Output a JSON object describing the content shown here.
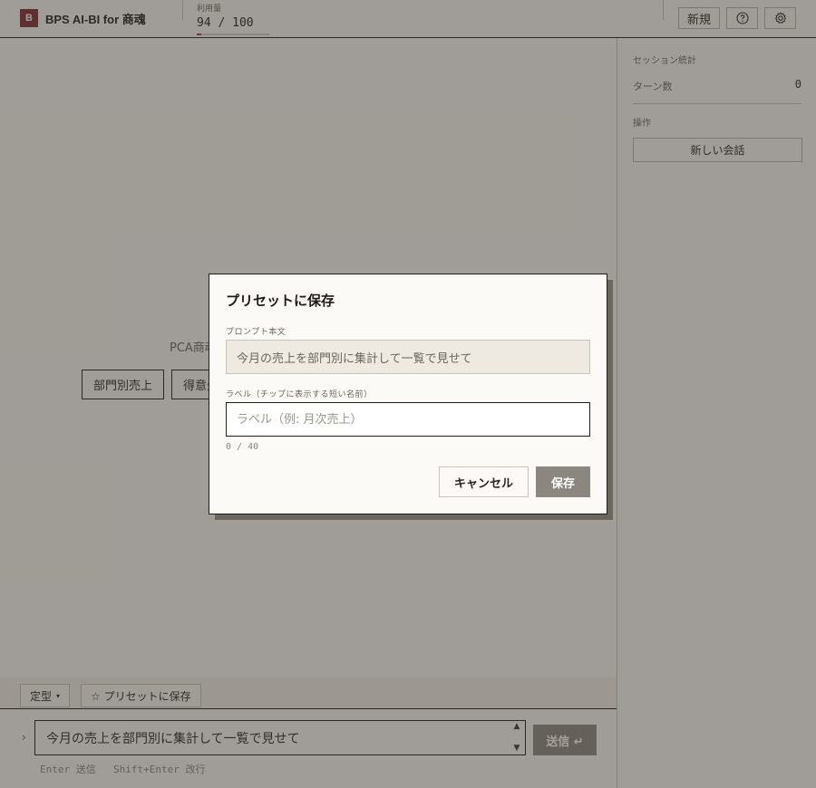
{
  "header": {
    "logo_letter": "B",
    "app_title": "BPS AI-BI for 商魂",
    "usage_label": "利用量",
    "usage_value": "94 / 100",
    "usage_fraction": 0.06,
    "new_label": "新規",
    "help_icon": "question-circle-icon",
    "settings_icon": "gear-icon"
  },
  "main": {
    "welcome_text": "PCA商魂",
    "chips": [
      "部門別売上",
      "得意先"
    ],
    "toolbar": {
      "template_label": "定型",
      "template_caret": "▾",
      "preset_label": "☆ プリセットに保存"
    },
    "composer": {
      "caret": "›",
      "input_value": "今月の売上を部門別に集計して一覧で見せて",
      "send_label": "送信 ↵",
      "hint_enter": "Enter 送信",
      "hint_shift": "Shift+Enter 改行"
    }
  },
  "sidebar": {
    "session_title": "セッション統計",
    "turn_label": "ターン数",
    "turn_value": "0",
    "ops_title": "操作",
    "new_chat_label": "新しい会話"
  },
  "modal": {
    "title": "プリセットに保存",
    "body_label": "プロンプト本文",
    "body_value": "今月の売上を部門別に集計して一覧で見せて",
    "label_label": "ラベル（チップに表示する短い名前）",
    "label_placeholder": "ラベル（例: 月次売上）",
    "counter": "0 / 40",
    "cancel_label": "キャンセル",
    "save_label": "保存"
  },
  "colors": {
    "brand": "#7c2a32",
    "usage_bar": "#a83240",
    "disabled_button": "#8b8780"
  }
}
